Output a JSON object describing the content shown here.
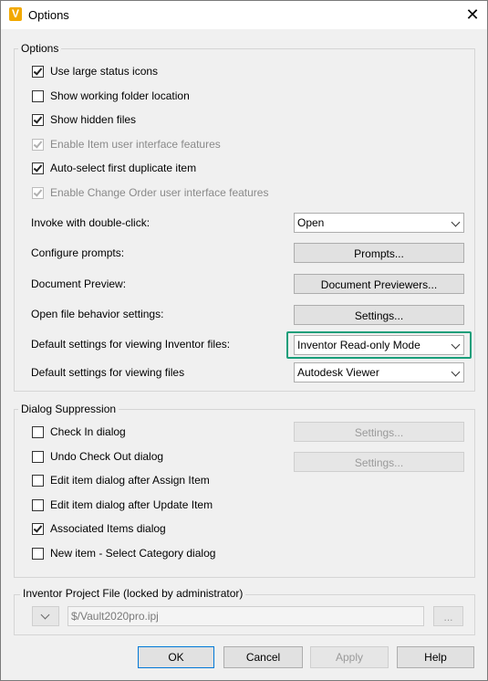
{
  "window": {
    "title": "Options",
    "app_icon_letter": "V",
    "close_glyph": "✕"
  },
  "options_group": {
    "label": "Options",
    "checkboxes": [
      {
        "label": "Use large status icons",
        "checked": true,
        "enabled": true
      },
      {
        "label": "Show working folder location",
        "checked": false,
        "enabled": true
      },
      {
        "label": "Show hidden files",
        "checked": true,
        "enabled": true
      },
      {
        "label": "Enable Item user interface features",
        "checked": true,
        "enabled": false
      },
      {
        "label": "Auto-select first duplicate item",
        "checked": true,
        "enabled": true
      },
      {
        "label": "Enable Change Order user interface features",
        "checked": true,
        "enabled": false
      }
    ],
    "invoke_label": "Invoke with double-click:",
    "invoke_value": "Open",
    "prompts_label": "Configure prompts:",
    "prompts_button": "Prompts...",
    "preview_label": "Document Preview:",
    "preview_button": "Document Previewers...",
    "open_behavior_label": "Open file behavior settings:",
    "open_behavior_button": "Settings...",
    "inventor_view_label": "Default settings for viewing Inventor files:",
    "inventor_view_value": "Inventor Read-only Mode",
    "files_view_label": "Default settings for viewing files",
    "files_view_value": "Autodesk Viewer"
  },
  "dialog_group": {
    "label": "Dialog Suppression",
    "checkboxes": [
      {
        "label": "Check In dialog",
        "checked": false
      },
      {
        "label": "Undo Check Out dialog",
        "checked": false
      },
      {
        "label": "Edit item dialog after Assign Item",
        "checked": false
      },
      {
        "label": "Edit item dialog after Update Item",
        "checked": false
      },
      {
        "label": "Associated Items dialog",
        "checked": true
      },
      {
        "label": "New item - Select Category dialog",
        "checked": false
      }
    ],
    "settings_button_1": "Settings...",
    "settings_button_2": "Settings..."
  },
  "project_group": {
    "label": "Inventor Project File (locked by administrator)",
    "path": "$/Vault2020pro.ipj",
    "browse_label": "..."
  },
  "footer": {
    "ok": "OK",
    "cancel": "Cancel",
    "apply": "Apply",
    "help": "Help"
  }
}
